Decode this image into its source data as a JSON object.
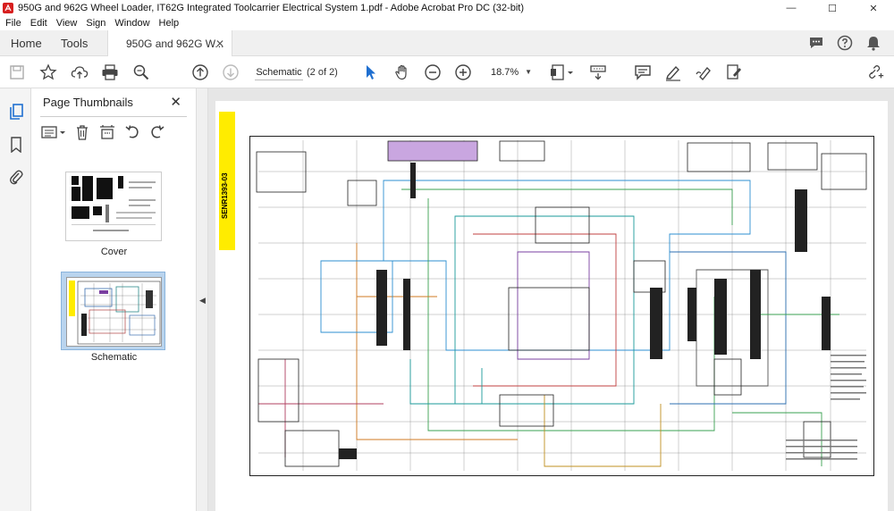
{
  "window": {
    "title": "950G and 962G Wheel Loader, IT62G Integrated Toolcarrier Electrical System  1.pdf - Adobe Acrobat Pro DC (32-bit)",
    "controls": {
      "minimize": "—",
      "maximize": "☐",
      "close": "✕"
    }
  },
  "menu": [
    "File",
    "Edit",
    "View",
    "Sign",
    "Window",
    "Help"
  ],
  "tabs": {
    "home": "Home",
    "tools": "Tools",
    "document": "950G and 962G W...",
    "close_glyph": "✕"
  },
  "toolbar": {
    "page_label": "Schematic",
    "page_count": "(2 of 2)",
    "zoom": "18.7%"
  },
  "thumbnails_panel": {
    "title": "Page Thumbnails",
    "close_glyph": "✕",
    "pages": [
      {
        "label": "Cover",
        "selected": false
      },
      {
        "label": "Schematic",
        "selected": true
      }
    ]
  },
  "document": {
    "strip_text": "SENR1393-03",
    "strip_color": "#ffec00"
  },
  "colors": {
    "accent_blue": "#1f6fd0",
    "selection": "#b9d4ee"
  }
}
